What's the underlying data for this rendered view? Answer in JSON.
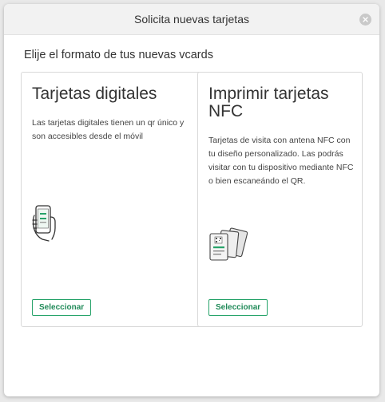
{
  "modal": {
    "title": "Solicita nuevas tarjetas",
    "close_icon": "close-icon"
  },
  "subtitle": "Elije el formato de tus nuevas vcards",
  "cards": [
    {
      "title": "Tarjetas digitales",
      "description": "Las tarjetas digitales tienen un qr único y son accesibles desde el móvil",
      "illustration_icon": "hand-holding-phone-icon",
      "button_label": "Seleccionar"
    },
    {
      "title": "Imprimir tarjetas NFC",
      "description": "Tarjetas de visita con antena NFC con tu diseño personalizado. Las podrás visitar con tu dispositivo mediante NFC o bien escaneándo el QR.",
      "illustration_icon": "nfc-cards-icon",
      "button_label": "Seleccionar"
    }
  ],
  "colors": {
    "accent": "#27a36a",
    "background": "#e9e9e9",
    "header": "#f2f2f2"
  }
}
